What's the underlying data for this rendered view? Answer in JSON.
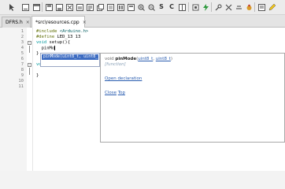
{
  "toolbar": {
    "icons": [
      "pointer-icon",
      "minimize-icon",
      "panel-icon",
      "save-icon",
      "save-all-icon",
      "close-tab-icon",
      "open-icon",
      "cut-icon",
      "copy-icon",
      "undo-icon",
      "paste-icon",
      "zoom-in-icon",
      "zoom-out-icon",
      "find-icon",
      "symbol-icon",
      "compile-icon",
      "book-icon",
      "upload-icon",
      "wrench-icon",
      "flash-icon",
      "disconnect-icon",
      "serial-icon",
      "settings-icon",
      "bug-icon",
      "tool-icon",
      "pen-icon"
    ],
    "s_label": "S",
    "c_label": "C"
  },
  "tabs": [
    {
      "label": "DFRS.h",
      "close": "×"
    },
    {
      "label": "*src\\resources.cpp",
      "close": "×"
    }
  ],
  "editor": {
    "line_numbers": [
      "1",
      "2",
      "3",
      "4",
      "5",
      "6",
      "7",
      "8",
      "9",
      "10",
      "11"
    ],
    "lines": {
      "l1_directive": "#include",
      "l1_arg": " <Arduino.h>",
      "l2_directive": "#define",
      "l2_arg": " LED_13 13",
      "l3_kw": "void",
      "l3_fn": " setup",
      "l3_rest": "(){",
      "l4_text": "  pinMo",
      "l5_text": "}",
      "l7_kw": "void",
      "l7_fn": " loop",
      "l7_rest": "(){",
      "l9_text": "}"
    }
  },
  "autocomplete": {
    "item": "pinMode(uint8_t, uint8_t)",
    "doc": {
      "prefix": "void ",
      "name": "pinMode",
      "open_paren": "(",
      "p1": "uint8_t",
      "comma": ", ",
      "p2": "uint8_t",
      "close_paren": ")",
      "kind": "[function]",
      "open_declaration": "Open declaration",
      "close": "Close",
      "top": "Top"
    }
  },
  "colors": {
    "keyword": "#00979c",
    "selection": "#3d6cc2",
    "link": "#2a5db0"
  }
}
